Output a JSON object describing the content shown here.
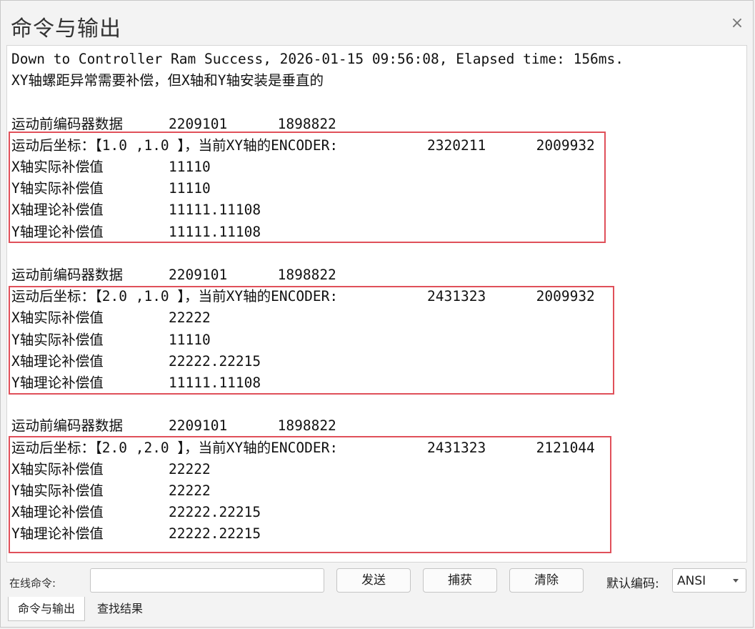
{
  "window": {
    "title": "命令与输出",
    "close_glyph": "×"
  },
  "output": {
    "lines": [
      "Down to Controller Ram Success, 2026-01-15 09:56:08, Elapsed time: 156ms.",
      "XY轴螺距异常需要补偿，但X轴和Y轴安装是垂直的",
      "",
      [
        "运动前编码器数据",
        "2209101      1898822"
      ],
      [
        "运动后坐标：【1.0 ,1.0 】，当前XY轴的ENCODER:",
        "2320211      2009932"
      ],
      [
        "X轴实际补偿值",
        "11110"
      ],
      [
        "Y轴实际补偿值",
        "11110"
      ],
      [
        "X轴理论补偿值",
        "11111.11108"
      ],
      [
        "Y轴理论补偿值",
        "11111.11108"
      ],
      "",
      [
        "运动前编码器数据",
        "2209101      1898822"
      ],
      [
        "运动后坐标：【2.0 ,1.0 】，当前XY轴的ENCODER:",
        "2431323      2009932"
      ],
      [
        "X轴实际补偿值",
        "22222"
      ],
      [
        "Y轴实际补偿值",
        "11110"
      ],
      [
        "X轴理论补偿值",
        "22222.22215"
      ],
      [
        "Y轴理论补偿值",
        "11111.11108"
      ],
      "",
      [
        "运动前编码器数据",
        "2209101      1898822"
      ],
      [
        "运动后坐标：【2.0 ,2.0 】，当前XY轴的ENCODER:",
        "2431323      2121044"
      ],
      [
        "X轴实际补偿值",
        "22222"
      ],
      [
        "Y轴实际补偿值",
        "22222"
      ],
      [
        "X轴理论补偿值",
        "22222.22215"
      ],
      [
        "Y轴理论补偿值",
        "22222.22215"
      ]
    ]
  },
  "highlight_color": "#e0505a",
  "command_bar": {
    "label": "在线命令:",
    "input_value": "",
    "send_label": "发送",
    "capture_label": "捕获",
    "clear_label": "清除",
    "encoding_label": "默认编码:",
    "encoding_value": "ANSI"
  },
  "tabs": [
    {
      "label": "命令与输出",
      "active": true
    },
    {
      "label": "查找结果",
      "active": false
    }
  ]
}
